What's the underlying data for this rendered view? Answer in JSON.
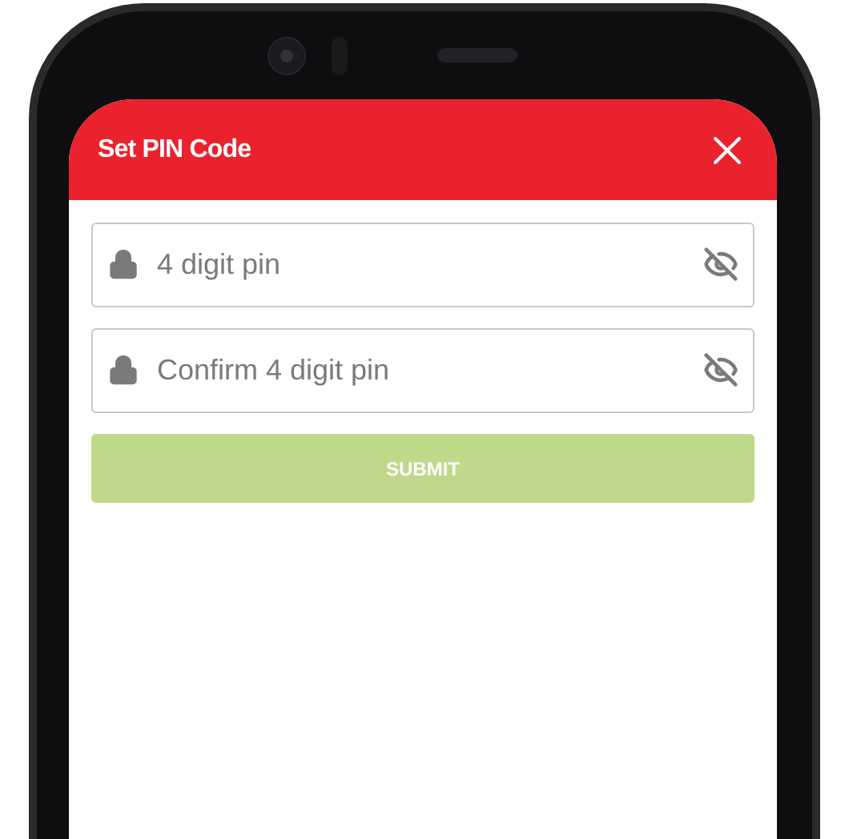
{
  "dialog": {
    "title": "Set PIN Code"
  },
  "fields": [
    {
      "placeholder": "4 digit pin",
      "visible": false
    },
    {
      "placeholder": "Confirm 4 digit pin",
      "visible": false
    }
  ],
  "submit": {
    "label": "SUBMIT",
    "disabled": true
  }
}
